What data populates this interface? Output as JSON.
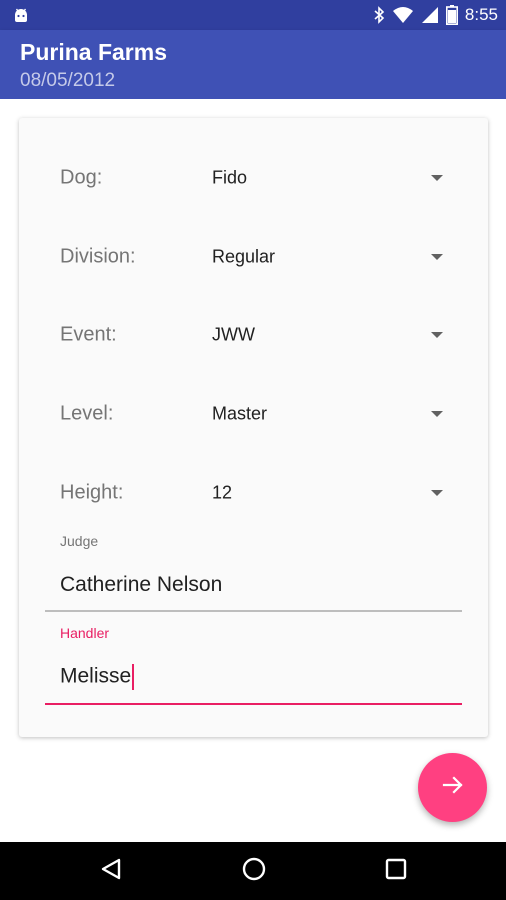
{
  "status_bar": {
    "time": "8:55",
    "icons": [
      "android-icon",
      "bluetooth-icon",
      "wifi-icon",
      "signal-icon",
      "battery-icon"
    ]
  },
  "app_bar": {
    "title": "Purina Farms",
    "subtitle": "08/05/2012",
    "color": "#3f51b5"
  },
  "form": {
    "dog": {
      "label": "Dog:",
      "value": "Fido"
    },
    "division": {
      "label": "Division:",
      "value": "Regular"
    },
    "event": {
      "label": "Event:",
      "value": "JWW"
    },
    "level": {
      "label": "Level:",
      "value": "Master"
    },
    "height": {
      "label": "Height:",
      "value": "12"
    },
    "judge": {
      "label": "Judge",
      "value": "Catherine Nelson"
    },
    "handler": {
      "label": "Handler",
      "value": "Melisse"
    }
  },
  "fab": {
    "icon": "arrow-right-icon",
    "color": "#ff4081"
  },
  "nav_bar": {
    "icons": [
      "back-icon",
      "home-icon",
      "recents-icon"
    ]
  }
}
